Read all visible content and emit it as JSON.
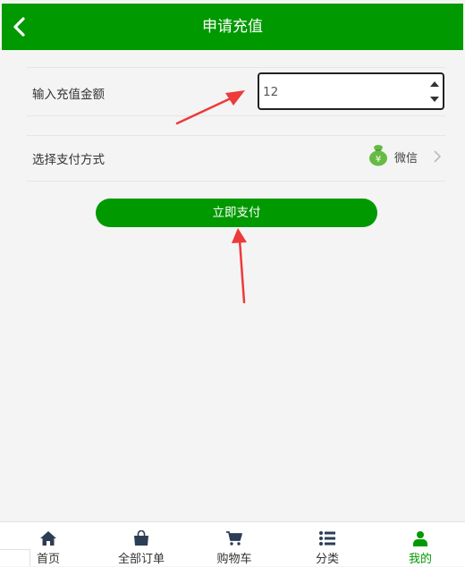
{
  "header": {
    "title": "申请充值"
  },
  "form": {
    "amount_label": "输入充值金额",
    "amount_value": "12",
    "payment_label": "选择支付方式",
    "payment_method": "微信",
    "payment_icon_glyph": "¥"
  },
  "pay_button_label": "立即支付",
  "colors": {
    "brand_green": "#009900",
    "arrow_red": "#ee3a3a",
    "wechat_pay_green": "#66bb44"
  },
  "tabs": [
    {
      "label": "首页",
      "icon": "home-icon",
      "active": false
    },
    {
      "label": "全部订单",
      "icon": "shopping-bag-icon",
      "active": false
    },
    {
      "label": "购物车",
      "icon": "cart-icon",
      "active": false
    },
    {
      "label": "分类",
      "icon": "list-icon",
      "active": false
    },
    {
      "label": "我的",
      "icon": "user-icon",
      "active": true
    }
  ]
}
